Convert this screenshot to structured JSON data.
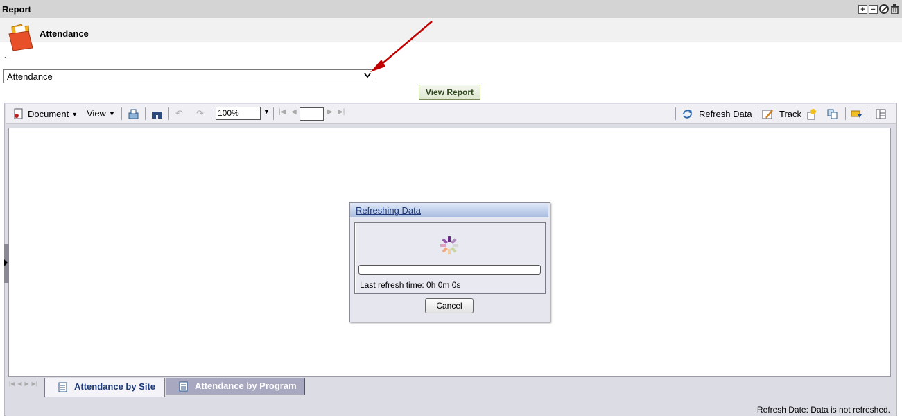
{
  "header": {
    "title": "Report",
    "controls": [
      "expand-icon",
      "collapse-icon",
      "block-icon",
      "trash-icon"
    ]
  },
  "report": {
    "heading": "Attendance",
    "icon": "folder-icon",
    "backtick": "`",
    "select_value": "Attendance",
    "view_button": "View Report"
  },
  "toolbar": {
    "document": "Document",
    "view": "View",
    "zoom": "100%",
    "page": "",
    "refresh_data": "Refresh Data",
    "track": "Track"
  },
  "dialog": {
    "title": "Refreshing Data",
    "progress": 0,
    "last_refresh": "Last refresh time: 0h 0m 0s",
    "cancel": "Cancel"
  },
  "tabs": [
    {
      "label": "Attendance by Site",
      "active": true
    },
    {
      "label": "Attendance by Program",
      "active": false
    }
  ],
  "status": {
    "refresh_date": "Refresh Date: Data is not refreshed."
  },
  "colors": {
    "annotation_arrow": "#c00000",
    "view_button_text": "#2f4a1f",
    "dialog_title": "#1f3a78"
  }
}
